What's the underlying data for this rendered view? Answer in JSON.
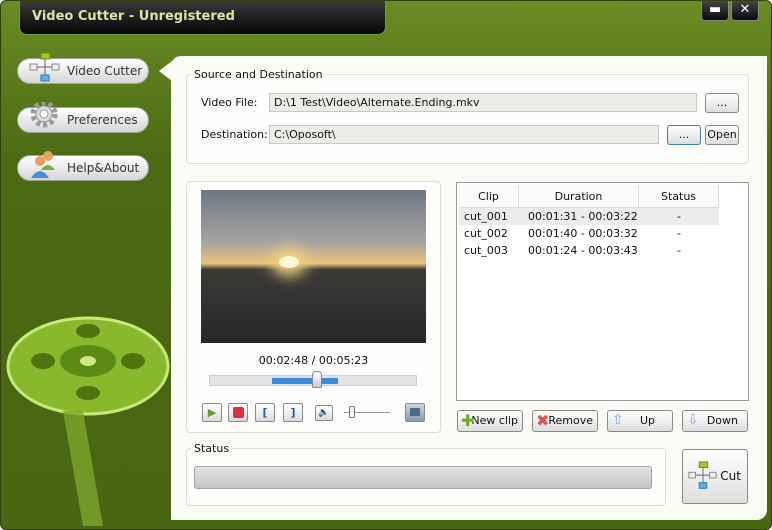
{
  "window": {
    "title": "Video Cutter - Unregistered",
    "minimize": "▬",
    "close": "✕"
  },
  "sidebar": {
    "items": [
      {
        "label": "Video Cutter",
        "icon": "flowchart-icon"
      },
      {
        "label": "Preferences",
        "icon": "gear-icon"
      },
      {
        "label": "Help&About",
        "icon": "users-icon"
      }
    ]
  },
  "source": {
    "group_label": "Source and Destination",
    "video_file_label": "Video File:",
    "video_file_value": "D:\\1 Test\\Video\\Alternate.Ending.mkv",
    "browse_label": "...",
    "destination_label": "Destination:",
    "destination_value": "C:\\Oposoft\\",
    "dest_browse_label": "...",
    "open_label": "Open"
  },
  "player": {
    "time": "00:02:48 / 00:05:23",
    "position": 0.52,
    "selection_start": 0.3,
    "selection_end": 0.62,
    "volume": 0.1,
    "mark_in": "[",
    "mark_out": "]"
  },
  "clips": {
    "columns": [
      "Clip",
      "Duration",
      "Status"
    ],
    "rows": [
      {
        "clip": "cut_001",
        "duration": "00:01:31 - 00:03:22",
        "status": "-"
      },
      {
        "clip": "cut_002",
        "duration": "00:01:40 - 00:03:32",
        "status": "-"
      },
      {
        "clip": "cut_003",
        "duration": "00:01:24 - 00:03:43",
        "status": "-"
      }
    ]
  },
  "actions": {
    "new_clip": "New clip",
    "remove": "Remove",
    "up": "Up",
    "down": "Down"
  },
  "status": {
    "group_label": "Status",
    "progress": 0,
    "cut_label": "Cut"
  }
}
